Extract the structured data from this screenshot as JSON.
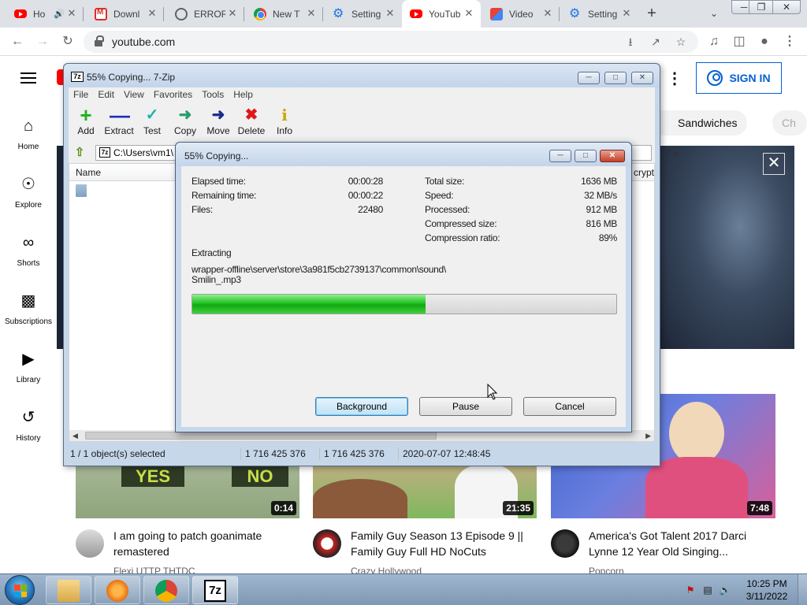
{
  "browser": {
    "tabs": [
      {
        "title": "Ho",
        "favicon": "youtube-icon",
        "active": false,
        "extra": "audio-icon"
      },
      {
        "title": "Downl",
        "favicon": "gmail-icon",
        "active": false
      },
      {
        "title": "ERROR",
        "favicon": "globe-icon",
        "active": false
      },
      {
        "title": "New T",
        "favicon": "chrome-icon",
        "active": false
      },
      {
        "title": "Setting",
        "favicon": "gear-icon",
        "active": false
      },
      {
        "title": "YouTub",
        "favicon": "youtube-icon",
        "active": true
      },
      {
        "title": "Video",
        "favicon": "video-icon",
        "active": false
      },
      {
        "title": "Setting",
        "favicon": "gear-icon",
        "active": false
      }
    ],
    "url": "youtube.com"
  },
  "youtube": {
    "sign_in": "SIGN IN",
    "sidebar": [
      {
        "label": "Home",
        "icon": "home-icon"
      },
      {
        "label": "Explore",
        "icon": "compass-icon"
      },
      {
        "label": "Shorts",
        "icon": "shorts-icon"
      },
      {
        "label": "Subscriptions",
        "icon": "subscriptions-icon"
      },
      {
        "label": "Library",
        "icon": "library-icon"
      },
      {
        "label": "History",
        "icon": "history-icon"
      }
    ],
    "chips": [
      "Sandwiches",
      "Ch"
    ],
    "videos": [
      {
        "title": "I am going to patch goanimate remastered",
        "channel": "Flexi UTTP THTDC",
        "duration": "0:14"
      },
      {
        "title": "Family Guy Season 13 Episode 9 || Family Guy Full HD NoCuts",
        "channel": "Crazy Hollywood",
        "duration": "21:35"
      },
      {
        "title": "America's Got Talent 2017 Darci Lynne 12 Year Old Singing...",
        "channel": "Popcorn",
        "duration": "7:48"
      }
    ],
    "thumb_text": {
      "yes": "YES",
      "no": "NO"
    }
  },
  "zip": {
    "title": "55% Copying... 7-Zip",
    "app_icon_text": "7z",
    "menu": [
      "File",
      "Edit",
      "View",
      "Favorites",
      "Tools",
      "Help"
    ],
    "toolbar": [
      {
        "label": "Add",
        "icon": "plus-icon"
      },
      {
        "label": "Extract",
        "icon": "minus-icon"
      },
      {
        "label": "Test",
        "icon": "check-icon"
      },
      {
        "label": "Copy",
        "icon": "copy-arrow-icon"
      },
      {
        "label": "Move",
        "icon": "move-arrow-icon"
      },
      {
        "label": "Delete",
        "icon": "delete-x-icon"
      },
      {
        "label": "Info",
        "icon": "info-icon"
      }
    ],
    "path": "C:\\Users\\vm1\\",
    "columns": {
      "name": "Name",
      "crypt": "crypt"
    },
    "status": {
      "selected": "1 / 1 object(s) selected",
      "size1": "1 716 425 376",
      "size2": "1 716 425 376",
      "date": "2020-07-07 12:48:45"
    }
  },
  "dialog": {
    "title": "55% Copying...",
    "elapsed_label": "Elapsed time:",
    "elapsed_value": "00:00:28",
    "remaining_label": "Remaining time:",
    "remaining_value": "00:00:22",
    "files_label": "Files:",
    "files_value": "22480",
    "total_label": "Total size:",
    "total_value": "1636 MB",
    "speed_label": "Speed:",
    "speed_value": "32 MB/s",
    "processed_label": "Processed:",
    "processed_value": "912 MB",
    "compressed_label": "Compressed size:",
    "compressed_value": "816 MB",
    "ratio_label": "Compression ratio:",
    "ratio_value": "89%",
    "operation": "Extracting",
    "path_line1": "wrapper-offline\\server\\store\\3a981f5cb2739137\\common\\sound\\",
    "path_line2": "Smilin_.mp3",
    "progress_fraction": 0.55,
    "buttons": {
      "background": "Background",
      "pause": "Pause",
      "cancel": "Cancel"
    }
  },
  "taskbar": {
    "time": "10:25 PM",
    "date": "3/11/2022",
    "apps": [
      "explorer-icon",
      "media-player-icon",
      "chrome-icon",
      "7zip-icon"
    ],
    "seven_zip_label": "7z"
  }
}
